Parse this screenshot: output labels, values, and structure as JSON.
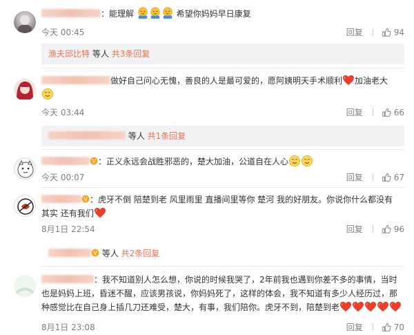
{
  "comments": [
    {
      "text": "：能理解",
      "text2": "希望你妈妈早日康复",
      "time": "今天 00:45",
      "reply": "回复",
      "likes": "94",
      "subreplies": {
        "name": "渔夫邱比特",
        "suffix": "等人",
        "more": "共3条回复"
      }
    },
    {
      "text": "做好自己问心无愧，善良的人是最可爱的，愿阿姨明天手术顺利",
      "text2": "加油老大",
      "time": "今天 03:44",
      "reply": "回复",
      "likes": "66",
      "subreplies": {
        "name": "",
        "suffix": "等人",
        "more": "共1条回复"
      }
    },
    {
      "text": "：正义永远会战胜邪恶的，楚大加油，公道自在人心",
      "time": "今天 00:07",
      "reply": "回复",
      "likes": "67"
    },
    {
      "text": "：虎牙不倒 陪楚到老 风里雨里 直播间里等你 楚河 我的好朋友。你说你什么都没有",
      "text2": "其实 还有我们",
      "time": "8月1日 22:54",
      "reply": "回复",
      "likes": "96",
      "subreplies": {
        "name": "",
        "suffix": "等人",
        "more": "共2条回复"
      }
    },
    {
      "text": "：我不知道别人怎么想，你说的时候我哭了，2年前我也遇到你差不多的事情，当时",
      "text2": "也是妈妈上班，昏迷不醒，应该男孩说，你妈妈死了，这样的体会，我不知道有多少人经历过，那",
      "text3": "种感觉比在自己身上插几刀还难受，楚大，有事，我们陪你。虎牙不到，陪楚到老",
      "time": "8月1日 23:08",
      "reply": "回复",
      "likes": "70"
    }
  ],
  "colors": {
    "accent": "#eb7350",
    "muted": "#808080",
    "heart": "#e8402a",
    "sub_bg": "#f2f2f5"
  }
}
